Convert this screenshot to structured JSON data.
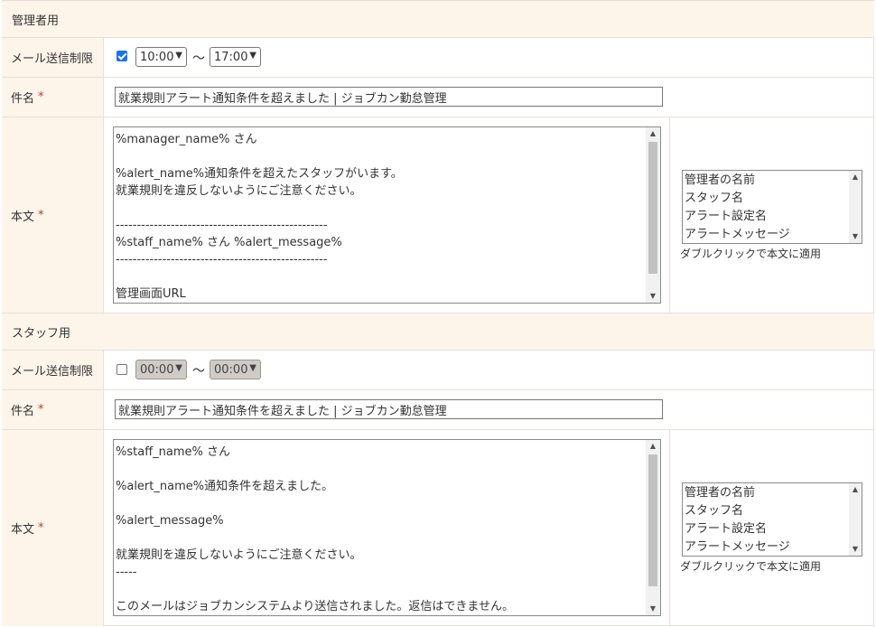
{
  "manager": {
    "section_title": "管理者用",
    "limit_label": "メール送信制限",
    "limit_checked": true,
    "time_from": "10:00",
    "time_to": "17:00",
    "tilde": "〜",
    "subject_label": "件名",
    "required_mark": "*",
    "subject_value": "就業規則アラート通知条件を超えました | ジョブカン勤怠管理",
    "body_label": "本文",
    "body_lines": [
      "%manager_name% さん",
      "",
      "%alert_name%通知条件を超えたスタッフがいます。",
      "就業規則を違反しないようにご注意ください。",
      "",
      "--------------------------------------------------",
      "%staff_name% さん %alert_message%",
      "--------------------------------------------------",
      "",
      "管理画面URL"
    ],
    "variables": [
      "管理者の名前",
      "スタッフ名",
      "アラート設定名",
      "アラートメッセージ"
    ],
    "hint": "ダブルクリックで本文に適用"
  },
  "staff": {
    "section_title": "スタッフ用",
    "limit_label": "メール送信制限",
    "limit_checked": false,
    "time_from": "00:00",
    "time_to": "00:00",
    "tilde": "〜",
    "subject_label": "件名",
    "required_mark": "*",
    "subject_value": "就業規則アラート通知条件を超えました | ジョブカン勤怠管理",
    "body_label": "本文",
    "body_lines": [
      "%staff_name% さん",
      "",
      "%alert_name%通知条件を超えました。",
      "",
      "%alert_message%",
      "",
      "就業規則を違反しないようにご注意ください。",
      "-----",
      "",
      "このメールはジョブカンシステムより送信されました。返信はできません。"
    ],
    "variables": [
      "管理者の名前",
      "スタッフ名",
      "アラート設定名",
      "アラートメッセージ"
    ],
    "hint": "ダブルクリックで本文に適用"
  },
  "colors": {
    "label_bg": "#fdf4ea",
    "required": "#c0392b",
    "checkbox": "#1a73e8",
    "disabled_select": "#cfcbc7"
  }
}
